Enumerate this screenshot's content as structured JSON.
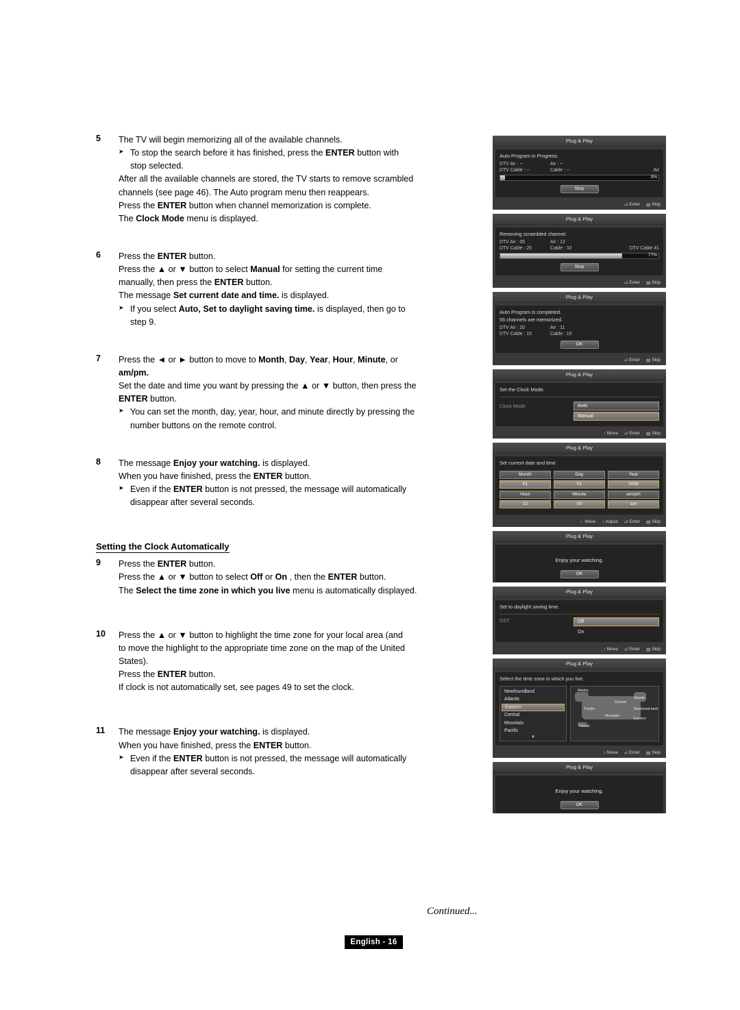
{
  "document": {
    "continued": "Continued...",
    "page_badge": "English - 16"
  },
  "steps": [
    {
      "num": "5",
      "lines": [
        {
          "type": "plain",
          "runs": [
            {
              "t": "The TV will begin memorizing all of the available channels."
            }
          ]
        },
        {
          "type": "arrow",
          "runs": [
            {
              "t": "To stop the search before it has finished, press the "
            },
            {
              "t": "ENTER",
              "b": true
            },
            {
              "t": " button with"
            }
          ]
        },
        {
          "type": "indent",
          "runs": [
            {
              "t": "stop selected."
            }
          ]
        },
        {
          "type": "plain",
          "runs": [
            {
              "t": "After all the available channels are stored, the TV starts to remove scrambled"
            }
          ]
        },
        {
          "type": "plain",
          "runs": [
            {
              "t": "channels (see page 46). The Auto program menu then reappears."
            }
          ]
        },
        {
          "type": "plain",
          "runs": [
            {
              "t": "Press the "
            },
            {
              "t": "ENTER",
              "b": true
            },
            {
              "t": " button when channel memorization is complete."
            }
          ]
        },
        {
          "type": "plain",
          "runs": [
            {
              "t": "The "
            },
            {
              "t": "Clock Mode",
              "b": true
            },
            {
              "t": " menu is displayed."
            }
          ]
        }
      ]
    },
    {
      "num": "6",
      "lines": [
        {
          "type": "plain",
          "runs": [
            {
              "t": "Press the "
            },
            {
              "t": "ENTER",
              "b": true
            },
            {
              "t": " button."
            }
          ]
        },
        {
          "type": "plain",
          "runs": [
            {
              "t": "Press the ▲ or ▼ button to select "
            },
            {
              "t": "Manual",
              "b": true
            },
            {
              "t": " for setting the current time"
            }
          ]
        },
        {
          "type": "plain",
          "runs": [
            {
              "t": "manually, then press the "
            },
            {
              "t": "ENTER",
              "b": true
            },
            {
              "t": " button."
            }
          ]
        },
        {
          "type": "plain",
          "runs": [
            {
              "t": "The message ",
              "b": false
            },
            {
              "t": "Set current date and time.",
              "b": true
            },
            {
              "t": " is displayed."
            }
          ]
        },
        {
          "type": "arrow",
          "runs": [
            {
              "t": "If you select "
            },
            {
              "t": "Auto, Set to daylight saving time.",
              "b": true
            },
            {
              "t": " is displayed, then go to"
            }
          ]
        },
        {
          "type": "indent",
          "runs": [
            {
              "t": "step 9."
            }
          ]
        }
      ]
    },
    {
      "num": "7",
      "lines": [
        {
          "type": "plain",
          "runs": [
            {
              "t": "Press the ◄ or ► button to move to "
            },
            {
              "t": "Month",
              "b": true
            },
            {
              "t": ", "
            },
            {
              "t": "Day",
              "b": true
            },
            {
              "t": ", "
            },
            {
              "t": "Year",
              "b": true
            },
            {
              "t": ", "
            },
            {
              "t": "Hour",
              "b": true
            },
            {
              "t": ", "
            },
            {
              "t": "Minute",
              "b": true
            },
            {
              "t": ", or"
            }
          ]
        },
        {
          "type": "plain",
          "runs": [
            {
              "t": "am/pm.",
              "b": true
            }
          ]
        },
        {
          "type": "plain",
          "runs": [
            {
              "t": "Set the date and time you want by pressing the ▲ or ▼ button, then press the"
            }
          ]
        },
        {
          "type": "plain",
          "runs": [
            {
              "t": "ENTER",
              "b": true
            },
            {
              "t": " button."
            }
          ]
        },
        {
          "type": "arrow",
          "runs": [
            {
              "t": "You can set the month, day, year, hour, and minute directly by pressing the"
            }
          ]
        },
        {
          "type": "indent",
          "runs": [
            {
              "t": "number buttons on the remote control."
            }
          ]
        }
      ]
    },
    {
      "num": "8",
      "lines": [
        {
          "type": "plain",
          "runs": [
            {
              "t": "The message "
            },
            {
              "t": "Enjoy your watching.",
              "b": true
            },
            {
              "t": " is displayed."
            }
          ]
        },
        {
          "type": "plain",
          "runs": [
            {
              "t": "When you have finished, press the "
            },
            {
              "t": "ENTER",
              "b": true
            },
            {
              "t": " button."
            }
          ]
        },
        {
          "type": "arrow",
          "runs": [
            {
              "t": "Even if the "
            },
            {
              "t": "ENTER",
              "b": true
            },
            {
              "t": " button is not pressed, the message will automatically"
            }
          ]
        },
        {
          "type": "indent",
          "runs": [
            {
              "t": "disappear after several seconds."
            }
          ]
        }
      ]
    }
  ],
  "section": {
    "heading": "Setting the Clock Automatically",
    "steps": [
      {
        "num": "9",
        "lines": [
          {
            "type": "plain",
            "runs": [
              {
                "t": "Press the "
              },
              {
                "t": "ENTER",
                "b": true
              },
              {
                "t": " button."
              }
            ]
          },
          {
            "type": "plain",
            "runs": [
              {
                "t": "Press the ▲ or ▼ button to select "
              },
              {
                "t": "Off",
                "b": true
              },
              {
                "t": " or "
              },
              {
                "t": "On",
                "b": true
              },
              {
                "t": " , then the "
              },
              {
                "t": "ENTER",
                "b": true
              },
              {
                "t": " button."
              }
            ]
          },
          {
            "type": "plain",
            "runs": [
              {
                "t": "The "
              },
              {
                "t": "Select the time zone in which you live",
                "b": true
              },
              {
                "t": " menu is automatically displayed."
              }
            ]
          }
        ]
      },
      {
        "num": "10",
        "lines": [
          {
            "type": "plain",
            "runs": [
              {
                "t": "Press the ▲ or ▼ button to highlight the time zone for your local area (and"
              }
            ]
          },
          {
            "type": "plain",
            "runs": [
              {
                "t": "to move the highlight to the appropriate time zone on the map of the United"
              }
            ]
          },
          {
            "type": "plain",
            "runs": [
              {
                "t": "States)."
              }
            ]
          },
          {
            "type": "plain",
            "runs": [
              {
                "t": "Press the "
              },
              {
                "t": "ENTER",
                "b": true
              },
              {
                "t": " button."
              }
            ]
          },
          {
            "type": "plain",
            "runs": [
              {
                "t": "If clock is not automatically set, see pages 49 to set the clock."
              }
            ]
          }
        ]
      },
      {
        "num": "11",
        "lines": [
          {
            "type": "plain",
            "runs": [
              {
                "t": "The message "
              },
              {
                "t": "Enjoy your watching.",
                "b": true
              },
              {
                "t": " is displayed."
              }
            ]
          },
          {
            "type": "plain",
            "runs": [
              {
                "t": "When you have finished, press the "
              },
              {
                "t": "ENTER",
                "b": true
              },
              {
                "t": " button."
              }
            ]
          },
          {
            "type": "arrow",
            "runs": [
              {
                "t": "Even if the "
              },
              {
                "t": "ENTER",
                "b": true
              },
              {
                "t": " button is not pressed, the message will automatically"
              }
            ]
          },
          {
            "type": "indent",
            "runs": [
              {
                "t": "disappear after several seconds."
              }
            ]
          }
        ]
      }
    ]
  },
  "panels": {
    "common_title": "Plug & Play",
    "footer": {
      "move": "Move",
      "adjust": "Adjust",
      "enter": "Enter",
      "skip": "Skip"
    },
    "p1": {
      "title": "Plug & Play",
      "line": "Auto Program in Progress.",
      "row1_a": "DTV Air : --",
      "row1_b": "Air : --",
      "row2_a": "DTV Cable : --",
      "row2_b": "Cable : --",
      "band": "Air",
      "percent": "3%",
      "progress": 3,
      "button": "Stop"
    },
    "p2": {
      "title": "Plug & Play",
      "line": "Removing scrambled channel.",
      "row1_a": "DTV Air : 05",
      "row1_b": "Air : 12",
      "row2_a": "DTV Cable : 25",
      "row2_b": "Cable : 32",
      "band": "DTV Cable 41",
      "percent": "77%",
      "progress": 77,
      "button": "Stop"
    },
    "p3": {
      "title": "Plug & Play",
      "line1": "Auto Program is completed.",
      "line2": "56 channels are memorized.",
      "row1_a": "DTV Air : 20",
      "row1_b": "Air : 11",
      "row2_a": "DTV Cable : 15",
      "row2_b": "Cable : 10",
      "button": "OK"
    },
    "p4": {
      "title": "Plug & Play",
      "line": "Set the Clock Mode.",
      "label": "Clock Mode",
      "opt1": "Auto",
      "opt2": "Manual"
    },
    "p5": {
      "title": "Plug & Play",
      "line": "Set current date and time",
      "h_month": "Month",
      "h_day": "Day",
      "h_year": "Year",
      "v_month": "01",
      "v_day": "01",
      "v_year": "2008",
      "h_hour": "Hour",
      "h_minute": "Minute",
      "h_ampm": "am/pm",
      "v_hour": "12",
      "v_minute": "00",
      "v_ampm": "am"
    },
    "p6": {
      "title": "Plug & Play",
      "message": "Enjoy your watching.",
      "button": "OK"
    },
    "p7": {
      "title": "Plug & Play",
      "line": "Set to daylight saving time.",
      "label": "DST",
      "opt1": "Off",
      "opt2": "On"
    },
    "p8": {
      "title": "Plug & Play",
      "line": "Select the time zone in which you live.",
      "zones": [
        "Newfoundland",
        "Atlantic",
        "Eastern",
        "Central",
        "Mountain",
        "Pacific"
      ],
      "selected_zone": "Eastern",
      "map_labels": [
        "Alaska",
        "Atlantic",
        "Central",
        "Pacific",
        "Newfound-land",
        "Mountain",
        "Eastern",
        "Hawaii"
      ]
    },
    "p9": {
      "title": "Plug & Play",
      "message": "Enjoy your watching.",
      "button": "OK"
    }
  }
}
